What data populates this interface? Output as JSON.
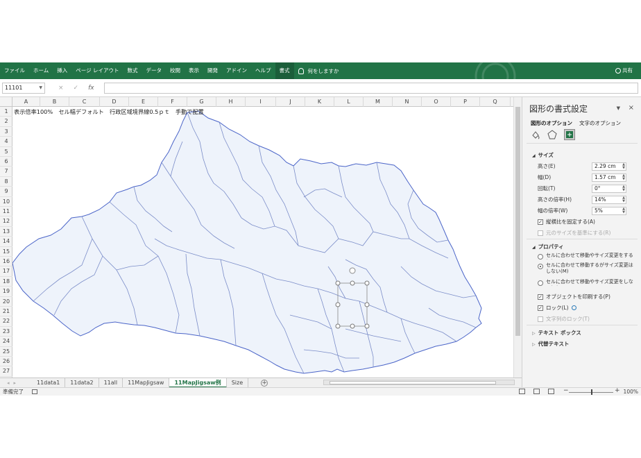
{
  "ribbon": {
    "tabs": [
      "ファイル",
      "ホーム",
      "挿入",
      "ページ レイアウト",
      "数式",
      "データ",
      "校閲",
      "表示",
      "開発",
      "アドイン",
      "ヘルプ",
      "書式"
    ],
    "active_tab": "書式",
    "tell_me": "何をしますか",
    "share": "共有"
  },
  "formula_bar": {
    "name_box": "11101",
    "cancel_icon": "×",
    "enter_icon": "✓",
    "fx_label": "fx",
    "formula": ""
  },
  "grid": {
    "columns": [
      "A",
      "B",
      "C",
      "D",
      "E",
      "F",
      "G",
      "H",
      "I",
      "J",
      "K",
      "L",
      "M",
      "N",
      "O",
      "P",
      "Q"
    ],
    "rows": [
      "1",
      "2",
      "3",
      "4",
      "5",
      "6",
      "7",
      "8",
      "9",
      "10",
      "11",
      "12",
      "13",
      "14",
      "15",
      "16",
      "17",
      "18",
      "19",
      "20",
      "21",
      "22",
      "23",
      "24",
      "25",
      "26",
      "27"
    ],
    "a1_text": "表示倍率100%　セル幅デフォルト　行政区域境界線0.5ｐｔ　手動で配置"
  },
  "sheet_tabs": {
    "tabs": [
      "11data1",
      "11data2",
      "11all",
      "11MapJigsaw",
      "11MapJigsaw例",
      "Size"
    ],
    "active": "11MapJigsaw例",
    "add_label": "+"
  },
  "status": {
    "ready": "準備完了",
    "zoom": "100%",
    "minus": "−",
    "plus": "+"
  },
  "panel": {
    "title": "図形の書式設定",
    "collapse": "▼",
    "close": "×",
    "tab_shape": "図形のオプション",
    "tab_text": "文字のオプション",
    "size_section": "サイズ",
    "height_label": "高さ(E)",
    "height_value": "2.29 cm",
    "width_label": "幅(D)",
    "width_value": "1.57 cm",
    "rotation_label": "回転(T)",
    "rotation_value": "0°",
    "scale_h_label": "高さの倍率(H)",
    "scale_h_value": "14%",
    "scale_w_label": "幅の倍率(W)",
    "scale_w_value": "5%",
    "lock_aspect": "縦横比を固定する(A)",
    "relative_original": "元のサイズを基準にする(R)",
    "properties_section": "プロパティ",
    "radio1": "セルに合わせて移動やサイズ変更をする(S)",
    "radio2": "セルに合わせて移動するがサイズ変更はしない(M)",
    "radio3": "セルに合わせて移動やサイズ変更をしない(D)",
    "print_object": "オブジェクトを印刷する(P)",
    "lock": "ロック(L)",
    "lock_text": "文字列のロック(T)",
    "textbox_section": "テキスト ボックス",
    "alt_text_section": "代替テキスト"
  },
  "colors": {
    "excel_green": "#217346",
    "map_fill": "#eef3fb",
    "map_stroke": "#4a64c8"
  }
}
